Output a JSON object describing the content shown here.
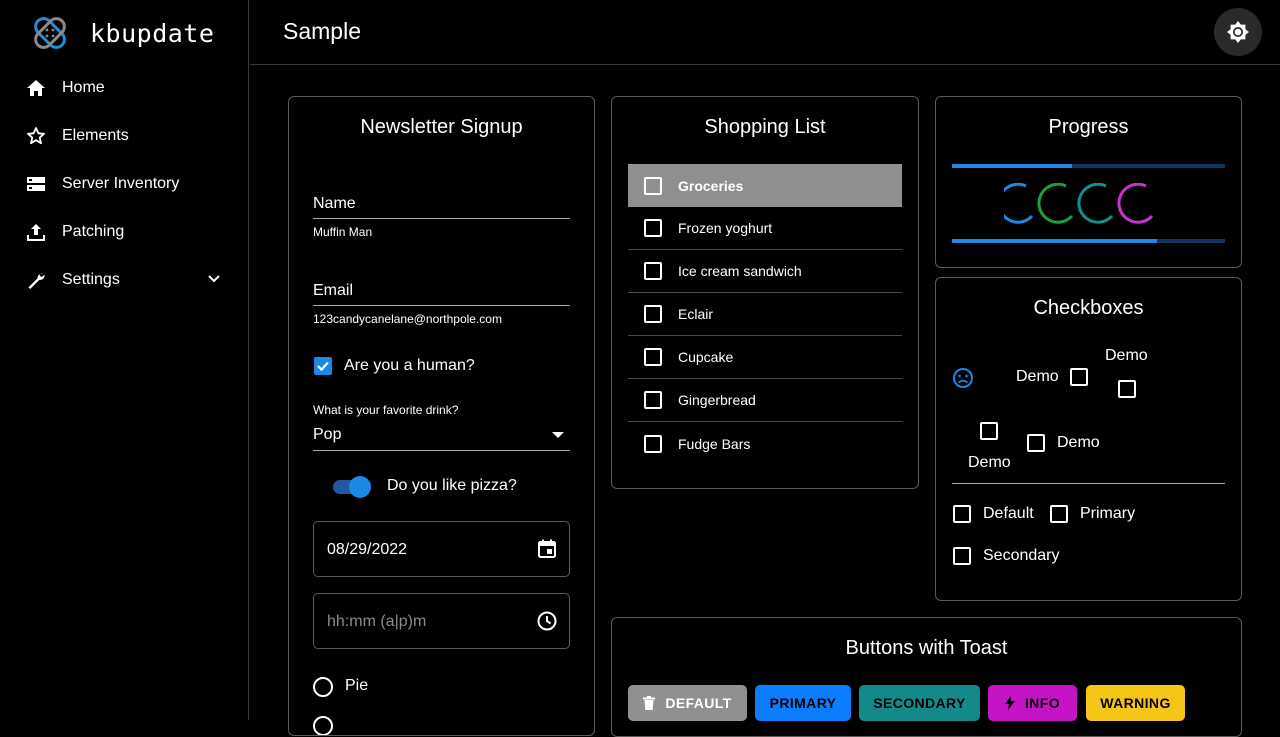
{
  "app": {
    "name": "kbupdate"
  },
  "nav": {
    "items": [
      {
        "label": "Home"
      },
      {
        "label": "Elements"
      },
      {
        "label": "Server Inventory"
      },
      {
        "label": "Patching"
      },
      {
        "label": "Settings"
      }
    ]
  },
  "header": {
    "title": "Sample"
  },
  "newsletter": {
    "title": "Newsletter Signup",
    "name_label": "Name",
    "name_value": "Muffin Man",
    "email_label": "Email",
    "email_value": "123candycanelane@northpole.com",
    "human_label": "Are you a human?",
    "human_checked": true,
    "drink_label": "What is your favorite drink?",
    "drink_value": "Pop",
    "pizza_label": "Do you like pizza?",
    "pizza_on": true,
    "date_value": "08/29/2022",
    "time_placeholder": "hh:mm (a|p)m",
    "radio_pie": "Pie"
  },
  "shopping": {
    "title": "Shopping List",
    "items": [
      {
        "label": "Groceries",
        "active": true
      },
      {
        "label": "Frozen yoghurt"
      },
      {
        "label": "Ice cream sandwich"
      },
      {
        "label": "Eclair"
      },
      {
        "label": "Cupcake"
      },
      {
        "label": "Gingerbread"
      },
      {
        "label": "Fudge Bars"
      }
    ]
  },
  "progress": {
    "title": "Progress",
    "bar1_fraction": 0.44,
    "bar2_fraction": 0.75,
    "spinner_colors": [
      "#1e88e5",
      "#1e9e3c",
      "#138f8c",
      "#cc33cc"
    ]
  },
  "checkboxes": {
    "title": "Checkboxes",
    "demo1": "Demo",
    "demo2": "Demo",
    "demo3": "Demo",
    "demo4": "Demo",
    "default": "Default",
    "primary": "Primary",
    "secondary": "Secondary"
  },
  "buttons": {
    "title": "Buttons with Toast",
    "default": "DEFAULT",
    "primary": "PRIMARY",
    "secondary": "SECONDARY",
    "info": "INFO",
    "warning": "WARNING",
    "colors": {
      "default": "#909090",
      "primary": "#0d7dff",
      "secondary": "#14898a",
      "info": "#c514c5",
      "warning": "#f5c518"
    }
  }
}
